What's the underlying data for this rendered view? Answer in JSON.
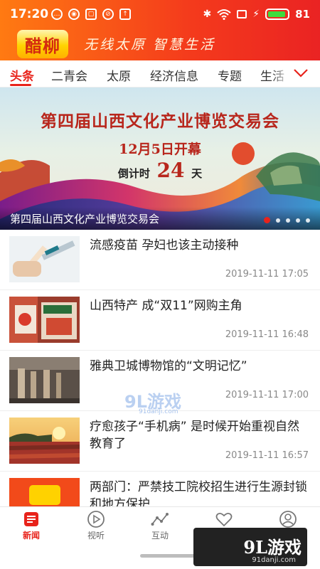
{
  "status_bar": {
    "time": "17:20",
    "battery": "81",
    "left_icons": [
      "message-icon",
      "weibo-icon",
      "image-icon",
      "block-icon",
      "upload-icon"
    ],
    "right_icons": [
      "bluetooth-icon",
      "wifi-icon",
      "screen-icon",
      "charging-icon",
      "battery-icon"
    ]
  },
  "brand": {
    "logo_text": "醋柳",
    "slogan": "无线太原  智慧生活"
  },
  "tabs": [
    {
      "label": "头条",
      "active": true
    },
    {
      "label": "二青会",
      "active": false
    },
    {
      "label": "太原",
      "active": false
    },
    {
      "label": "经济信息",
      "active": false
    },
    {
      "label": "专题",
      "active": false
    },
    {
      "label": "生活",
      "active": false
    }
  ],
  "banner": {
    "title": "第四届山西文化产业博览交易会",
    "date": "12月5日开幕",
    "countdown_label": "倒计时",
    "countdown_value": "24",
    "countdown_unit": "天",
    "caption": "第四届山西文化产业博览交易会"
  },
  "news": [
    {
      "title": "流感疫苗 孕妇也该主动接种",
      "time": "2019-11-11 17:05",
      "thumb": "vaccine"
    },
    {
      "title": "山西特产 成“双11”网购主角",
      "time": "2019-11-11 16:48",
      "thumb": "products"
    },
    {
      "title": "雅典卫城博物馆的“文明记忆”",
      "time": "2019-11-11 17:00",
      "thumb": "museum"
    },
    {
      "title": "疗愈孩子“手机病” 是时候开始重视自然教育了",
      "time": "2019-11-11 16:57",
      "thumb": "sunset"
    },
    {
      "title": "两部门：严禁技工院校招生进行生源封锁和地方保护",
      "time": "",
      "thumb": "logo"
    }
  ],
  "bottom_nav": [
    {
      "label": "新闻",
      "icon": "news-icon",
      "active": true
    },
    {
      "label": "视听",
      "icon": "play-icon",
      "active": false
    },
    {
      "label": "互动",
      "icon": "interact-icon",
      "active": false
    },
    {
      "label": "",
      "icon": "heart-icon",
      "active": false
    },
    {
      "label": "",
      "icon": "user-icon",
      "active": false
    }
  ],
  "watermark": {
    "text": "9L游戏",
    "sub": "91danji.com"
  },
  "colors": {
    "accent": "#e8231b",
    "header_start": "#ff7a12",
    "header_end": "#ea2323"
  }
}
